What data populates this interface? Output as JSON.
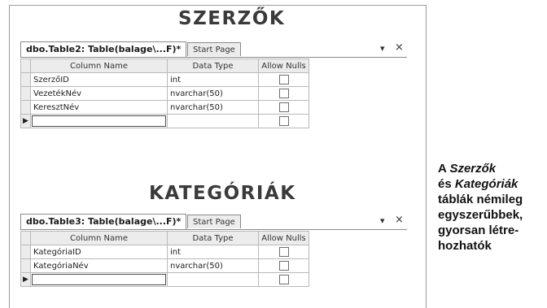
{
  "sections": [
    {
      "title": "SZERZŐK",
      "tabs": {
        "active": "dbo.Table2: Table(balage\\...F)*",
        "inactive": "Start Page"
      },
      "controls": {
        "dropdown": "▾",
        "close": "×"
      },
      "columns": [
        "Column Name",
        "Data Type",
        "Allow Nulls"
      ],
      "rows": [
        {
          "name": "SzerzőID",
          "type": "int"
        },
        {
          "name": "VezetékNév",
          "type": "nvarchar(50)"
        },
        {
          "name": "KeresztNév",
          "type": "nvarchar(50)"
        }
      ],
      "new_row_indicator": "▶"
    },
    {
      "title": "KATEGÓRIÁK",
      "tabs": {
        "active": "dbo.Table3: Table(balage\\...F)*",
        "inactive": "Start Page"
      },
      "controls": {
        "dropdown": "▾",
        "close": "×"
      },
      "columns": [
        "Column Name",
        "Data Type",
        "Allow Nulls"
      ],
      "rows": [
        {
          "name": "KategóriaID",
          "type": "int"
        },
        {
          "name": "KategóriaNév",
          "type": "nvarchar(50)"
        }
      ],
      "new_row_indicator": "▶"
    }
  ],
  "caption": {
    "line1_prefix": "A ",
    "line1_italic": "Szerzők",
    "line2_prefix": "és ",
    "line2_italic": "Kategóriák",
    "line3": "táblák némileg",
    "line4": "egyszerűbbek,",
    "line5": "gyorsan létre-",
    "line6": "hozhatók"
  }
}
